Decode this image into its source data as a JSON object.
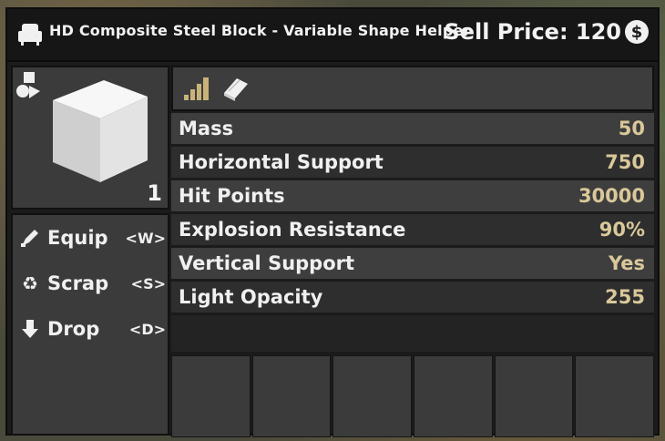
{
  "header": {
    "item_icon": "armchair-icon",
    "title": "HD Composite Steel Block - Variable Shape Helper",
    "sell_label": "Sell Price: 120",
    "currency_icon": "dollar-coin-icon"
  },
  "preview": {
    "shape_icon": "shape-helper-icon",
    "item_image": "steel-cube-image",
    "count": "1"
  },
  "actions": [
    {
      "icon": "equip-icon",
      "label": "Equip",
      "key": "<W>"
    },
    {
      "icon": "recycle-icon",
      "label": "Scrap",
      "key": "<S>"
    },
    {
      "icon": "arrow-down-icon",
      "label": "Drop",
      "key": "<D>"
    }
  ],
  "tabs": [
    {
      "icon": "quality-bars-icon"
    },
    {
      "icon": "book-icon"
    }
  ],
  "stats": [
    {
      "label": "Mass",
      "value": "50"
    },
    {
      "label": "Horizontal Support",
      "value": "750"
    },
    {
      "label": "Hit Points",
      "value": "30000"
    },
    {
      "label": "Explosion Resistance",
      "value": "90%"
    },
    {
      "label": "Vertical Support",
      "value": "Yes"
    },
    {
      "label": "Light Opacity",
      "value": "255"
    }
  ],
  "colors": {
    "stat_value": "#d9c89a",
    "tab_icon": "#c9b27a",
    "panel_bg": "#1b1b1b"
  }
}
